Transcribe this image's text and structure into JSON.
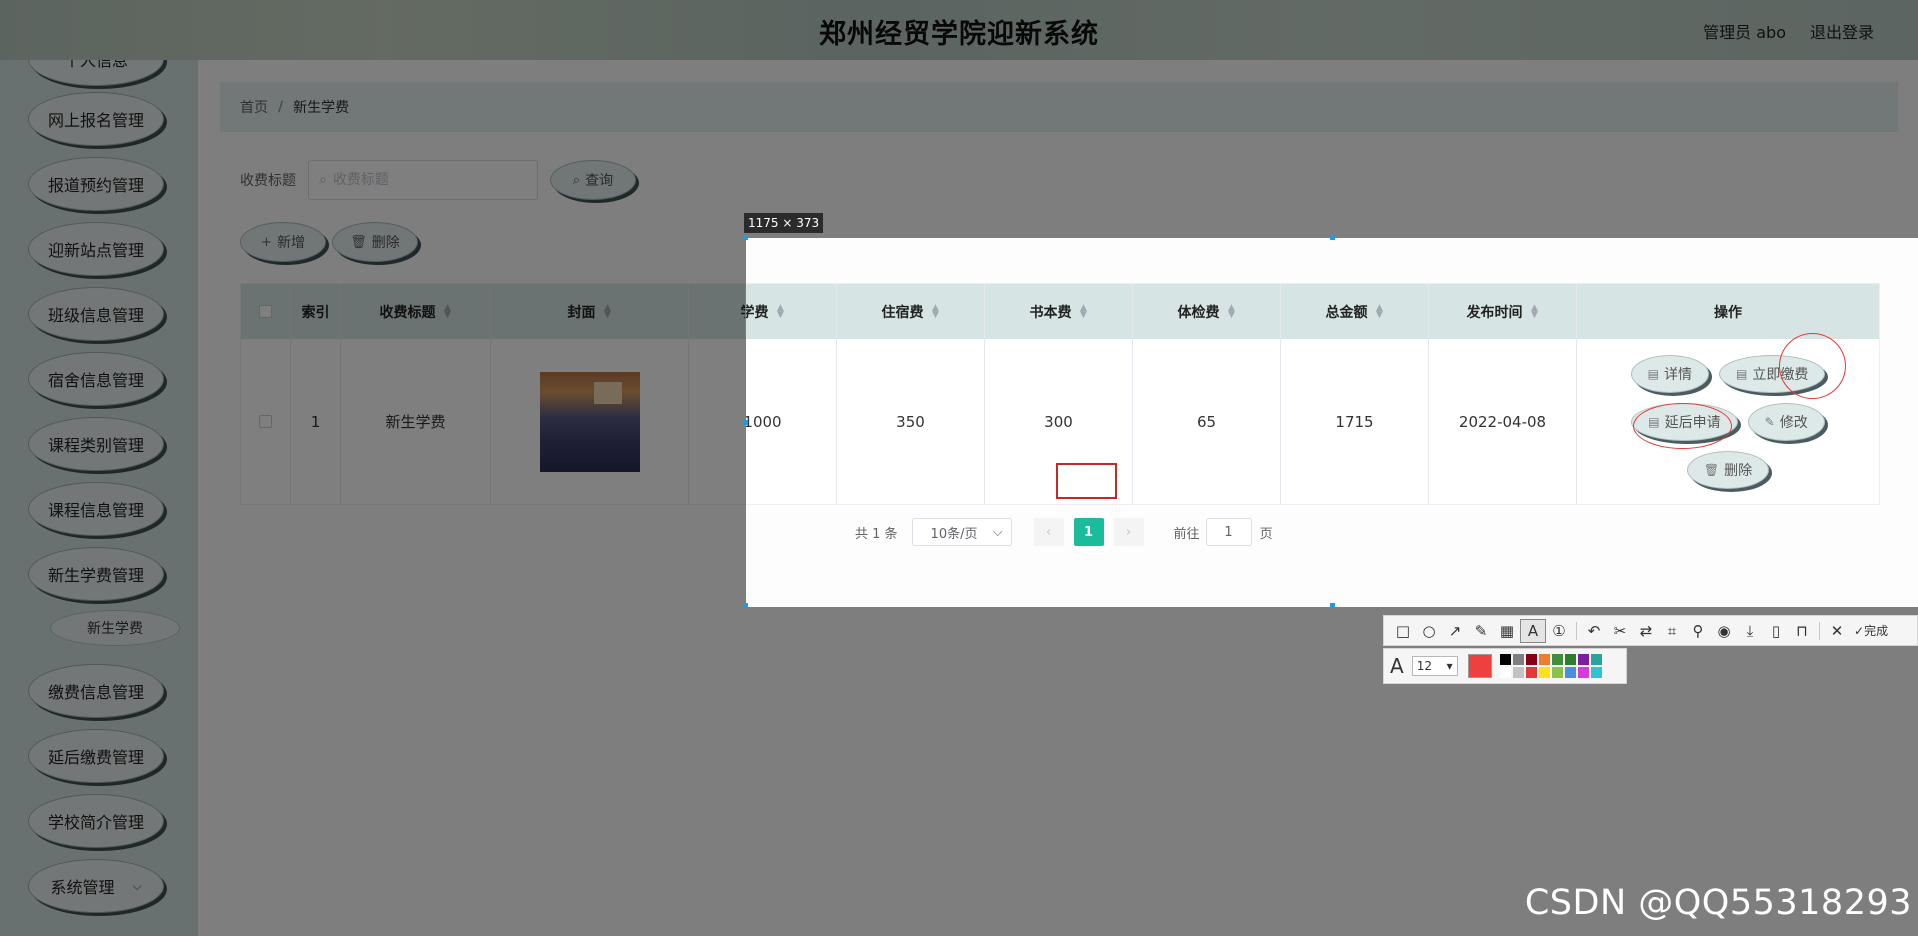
{
  "header": {
    "title": "郑州经贸学院迎新系统",
    "admin_label": "管理员 abo",
    "logout_label": "退出登录"
  },
  "sidebar": {
    "items": [
      {
        "label": "个人信息"
      },
      {
        "label": "网上报名管理"
      },
      {
        "label": "报道预约管理"
      },
      {
        "label": "迎新站点管理"
      },
      {
        "label": "班级信息管理"
      },
      {
        "label": "宿舍信息管理"
      },
      {
        "label": "课程类别管理"
      },
      {
        "label": "课程信息管理"
      },
      {
        "label": "新生学费管理"
      },
      {
        "label": "缴费信息管理"
      },
      {
        "label": "延后缴费管理"
      },
      {
        "label": "学校简介管理"
      },
      {
        "label": "系统管理"
      }
    ],
    "sub_item": "新生学费"
  },
  "breadcrumb": {
    "home": "首页",
    "sep": "/",
    "current": "新生学费"
  },
  "search": {
    "label": "收费标题",
    "placeholder": "收费标题",
    "button": "查询"
  },
  "actions": {
    "add": "新增",
    "delete": "删除"
  },
  "table": {
    "columns": [
      "索引",
      "收费标题",
      "封面",
      "学费",
      "住宿费",
      "书本费",
      "体检费",
      "总金额",
      "发布时间",
      "操作"
    ],
    "rows": [
      {
        "index": "1",
        "title": "新生学费",
        "tuition": "1000",
        "dorm": "350",
        "books": "300",
        "exam": "65",
        "total": "1715",
        "date": "2022-04-08"
      }
    ],
    "ops": {
      "detail": "详情",
      "pay": "立即缴费",
      "defer": "延后申请",
      "edit": "修改",
      "delete": "删除"
    }
  },
  "pager": {
    "total": "共 1 条",
    "size": "10条/页",
    "page": "1",
    "goto": "前往",
    "jump": "1",
    "page_unit": "页"
  },
  "screenshot_tool": {
    "size_label": "1175 × 373",
    "done_label": "完成",
    "font_size": "12",
    "current_color": "#ef4040",
    "palette": [
      "#000000",
      "#7f7f7f",
      "#880015",
      "#ed7d31",
      "#3f8f3f",
      "#2e7d32",
      "#7b1fa2",
      "#26a69a",
      "#ffffff",
      "#c3c3c3",
      "#e53935",
      "#ffe119",
      "#8bc34a",
      "#4a90e2",
      "#d63be0",
      "#2ec4d6"
    ]
  },
  "watermark": "CSDN @QQ55318293",
  "colors": {
    "accent": "#1abc9c",
    "sidebar_bg": "#d3e2e0",
    "header_bg": "#c2d3ca"
  }
}
